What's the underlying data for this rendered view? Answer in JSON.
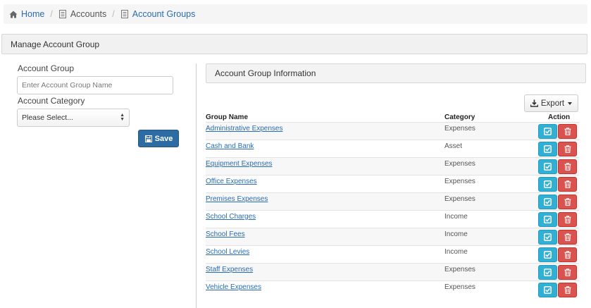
{
  "breadcrumb": {
    "home": "Home",
    "accounts": "Accounts",
    "account_groups": "Account Groups"
  },
  "manage_panel": {
    "title": "Manage Account Group",
    "account_group_label": "Account Group",
    "account_group_placeholder": "Enter Account Group Name",
    "account_category_label": "Account Category",
    "account_category_selected": "Please Select...",
    "save_label": "Save"
  },
  "info_panel": {
    "title": "Account Group Information",
    "export_label": "Export",
    "columns": [
      "Group Name",
      "Category",
      "Action"
    ],
    "rows": [
      {
        "name": "Administrative Expenses",
        "category": "Expenses"
      },
      {
        "name": "Cash and Bank",
        "category": "Asset"
      },
      {
        "name": "Equipment Expenses",
        "category": "Expenses"
      },
      {
        "name": "Office Expenses",
        "category": "Expenses"
      },
      {
        "name": "Premises Expenses",
        "category": "Expenses"
      },
      {
        "name": "School Charges",
        "category": "Income"
      },
      {
        "name": "School Fees",
        "category": "Income"
      },
      {
        "name": "School Levies",
        "category": "Income"
      },
      {
        "name": "Staff Expenses",
        "category": "Expenses"
      },
      {
        "name": "Vehicle Expenses",
        "category": "Expenses"
      }
    ]
  },
  "colors": {
    "link": "#2a6cb0",
    "save_button": "#2d6ca2",
    "edit_button": "#31b0d5",
    "delete_button": "#d9534f"
  },
  "icons": {
    "home": "home-icon",
    "accounts": "document-icon",
    "account_groups": "document-icon",
    "save": "floppy-disk-icon",
    "export": "download-icon",
    "edit": "checkbox-icon",
    "delete": "trash-icon"
  }
}
